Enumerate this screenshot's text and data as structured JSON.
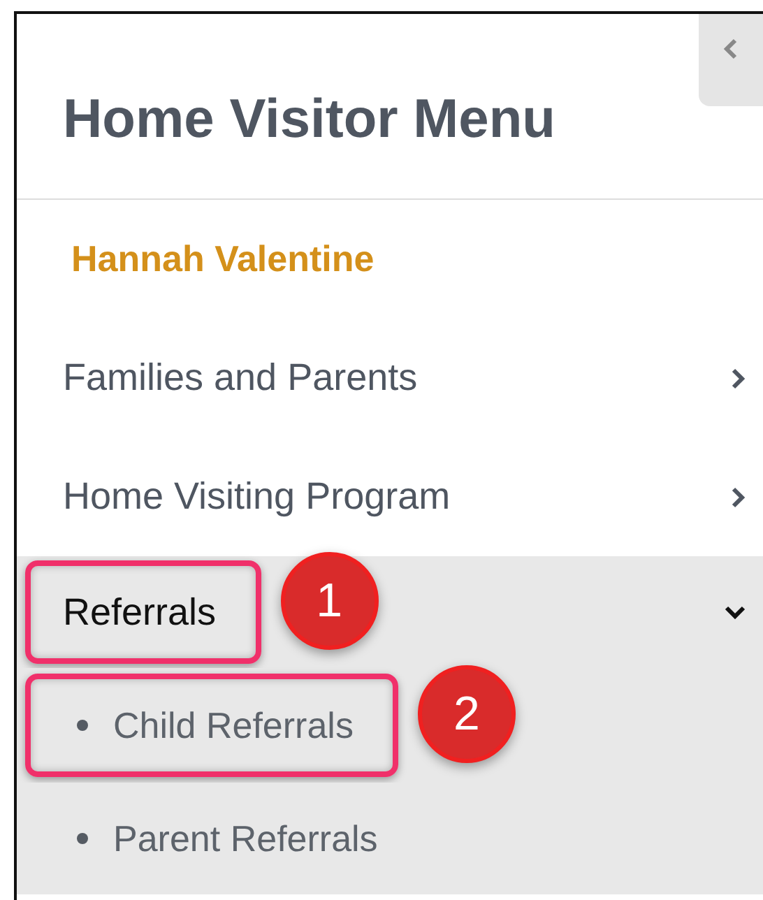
{
  "sidebar": {
    "title": "Home Visitor Menu",
    "user_name": "Hannah Valentine",
    "items": [
      {
        "label": "Families and Parents",
        "expanded": false,
        "highlighted": false
      },
      {
        "label": "Home Visiting Program",
        "expanded": false,
        "highlighted": false
      },
      {
        "label": "Referrals",
        "expanded": true,
        "highlighted": true,
        "callout": "1",
        "children": [
          {
            "label": "Child Referrals",
            "highlighted": true,
            "callout": "2"
          },
          {
            "label": "Parent Referrals",
            "highlighted": false
          }
        ]
      }
    ]
  }
}
